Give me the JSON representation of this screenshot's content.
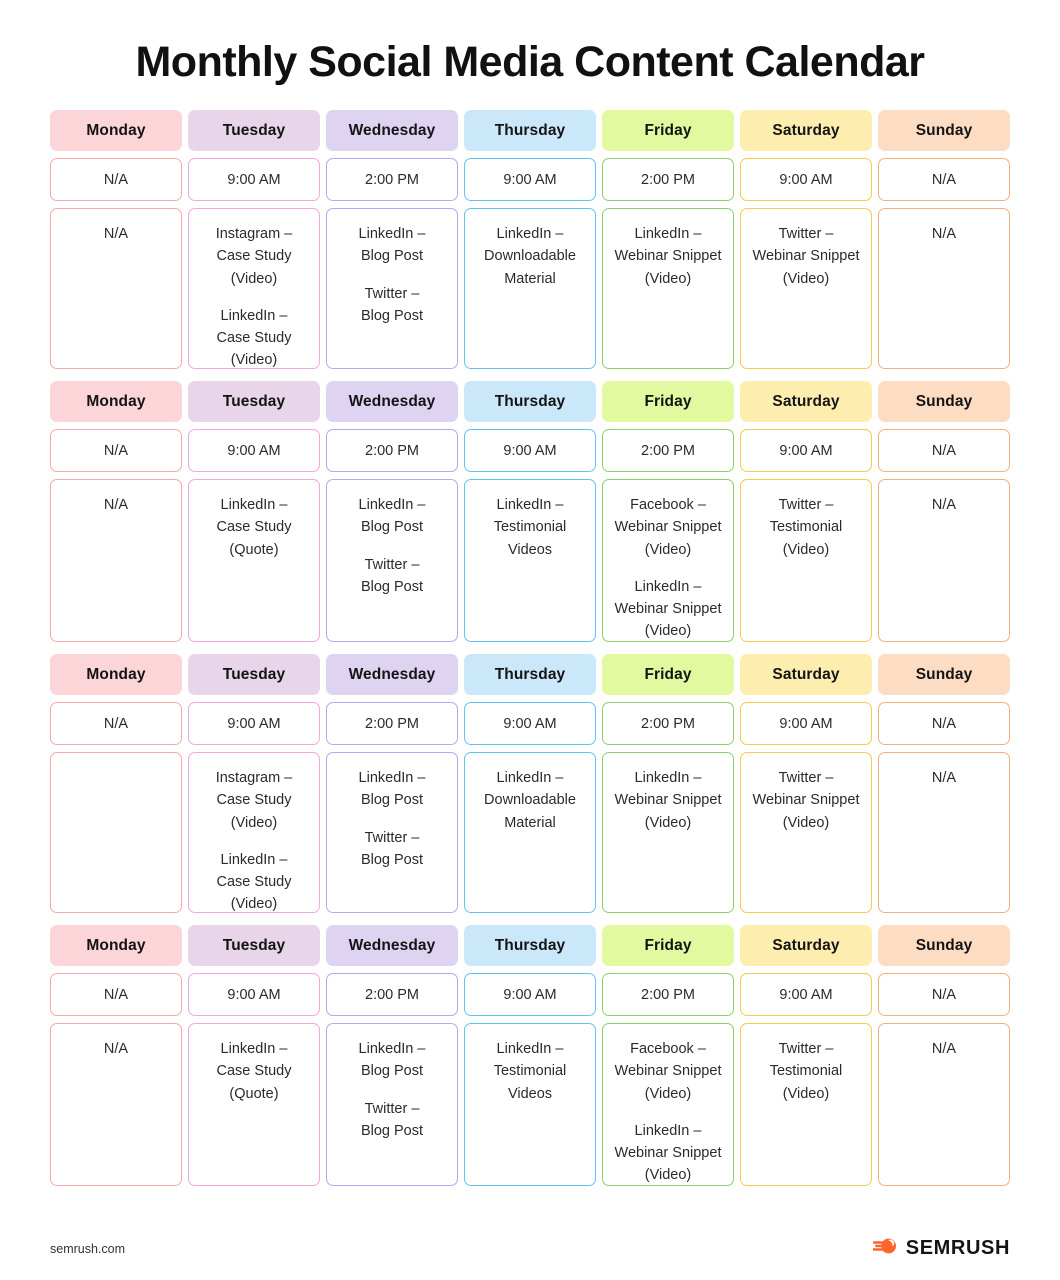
{
  "title": "Monthly Social Media Content Calendar",
  "footer": {
    "url": "semrush.com",
    "brand_name": "SEMRUSH",
    "brand_mark_color": "#ff642d"
  },
  "day_styles": {
    "Monday": {
      "header_bg": "#fbd5d8",
      "border": "#f7a8ab"
    },
    "Tuesday": {
      "header_bg": "#e8d5ea",
      "border": "#f5a7da"
    },
    "Wednesday": {
      "header_bg": "#ded4f2",
      "border": "#b9a6f2"
    },
    "Thursday": {
      "header_bg": "#cbe8fb",
      "border": "#63c3f0"
    },
    "Friday": {
      "header_bg": "#e2f9a0",
      "border": "#8dd06a"
    },
    "Saturday": {
      "header_bg": "#fdeeb0",
      "border": "#f7cb4b"
    },
    "Sunday": {
      "header_bg": "#fcddc4",
      "border": "#f4b07c"
    }
  },
  "weeks": [
    {
      "name": "week-1",
      "days": [
        {
          "day": "Monday",
          "time": "N/A",
          "entries": [
            "N/A"
          ]
        },
        {
          "day": "Tuesday",
          "time": "9:00 AM",
          "entries": [
            "Instagram –\nCase Study\n(Video)",
            "LinkedIn –\nCase Study\n(Video)"
          ]
        },
        {
          "day": "Wednesday",
          "time": "2:00 PM",
          "entries": [
            "LinkedIn –\nBlog Post",
            "Twitter –\nBlog Post"
          ]
        },
        {
          "day": "Thursday",
          "time": "9:00 AM",
          "entries": [
            "LinkedIn –\nDownloadable\nMaterial"
          ]
        },
        {
          "day": "Friday",
          "time": "2:00 PM",
          "entries": [
            "LinkedIn –\nWebinar Snippet\n(Video)"
          ]
        },
        {
          "day": "Saturday",
          "time": "9:00 AM",
          "entries": [
            "Twitter –\nWebinar Snippet\n(Video)"
          ]
        },
        {
          "day": "Sunday",
          "time": "N/A",
          "entries": [
            "N/A"
          ]
        }
      ]
    },
    {
      "name": "week-2",
      "days": [
        {
          "day": "Monday",
          "time": "N/A",
          "entries": [
            "N/A"
          ]
        },
        {
          "day": "Tuesday",
          "time": "9:00 AM",
          "entries": [
            "LinkedIn –\nCase Study\n(Quote)"
          ]
        },
        {
          "day": "Wednesday",
          "time": "2:00 PM",
          "entries": [
            "LinkedIn –\nBlog Post",
            "Twitter –\nBlog Post"
          ]
        },
        {
          "day": "Thursday",
          "time": "9:00 AM",
          "entries": [
            "LinkedIn –\nTestimonial\nVideos"
          ]
        },
        {
          "day": "Friday",
          "time": "2:00 PM",
          "entries": [
            "Facebook –\nWebinar Snippet\n(Video)",
            "LinkedIn –\nWebinar Snippet\n(Video)"
          ]
        },
        {
          "day": "Saturday",
          "time": "9:00 AM",
          "entries": [
            "Twitter –\nTestimonial\n(Video)"
          ]
        },
        {
          "day": "Sunday",
          "time": "N/A",
          "entries": [
            "N/A"
          ]
        }
      ]
    },
    {
      "name": "week-3",
      "days": [
        {
          "day": "Monday",
          "time": "N/A",
          "entries": []
        },
        {
          "day": "Tuesday",
          "time": "9:00 AM",
          "entries": [
            "Instagram –\nCase Study\n(Video)",
            "LinkedIn –\nCase Study\n(Video)"
          ]
        },
        {
          "day": "Wednesday",
          "time": "2:00 PM",
          "entries": [
            "LinkedIn –\nBlog Post",
            "Twitter –\nBlog Post"
          ]
        },
        {
          "day": "Thursday",
          "time": "9:00 AM",
          "entries": [
            "LinkedIn –\nDownloadable\nMaterial"
          ]
        },
        {
          "day": "Friday",
          "time": "2:00 PM",
          "entries": [
            "LinkedIn –\nWebinar Snippet\n(Video)"
          ]
        },
        {
          "day": "Saturday",
          "time": "9:00 AM",
          "entries": [
            "Twitter –\nWebinar Snippet\n(Video)"
          ]
        },
        {
          "day": "Sunday",
          "time": "N/A",
          "entries": [
            "N/A"
          ]
        }
      ]
    },
    {
      "name": "week-4",
      "days": [
        {
          "day": "Monday",
          "time": "N/A",
          "entries": [
            "N/A"
          ]
        },
        {
          "day": "Tuesday",
          "time": "9:00 AM",
          "entries": [
            "LinkedIn –\nCase Study\n(Quote)"
          ]
        },
        {
          "day": "Wednesday",
          "time": "2:00 PM",
          "entries": [
            "LinkedIn –\nBlog Post",
            "Twitter –\nBlog Post"
          ]
        },
        {
          "day": "Thursday",
          "time": "9:00 AM",
          "entries": [
            "LinkedIn –\nTestimonial\nVideos"
          ]
        },
        {
          "day": "Friday",
          "time": "2:00 PM",
          "entries": [
            "Facebook –\nWebinar Snippet\n(Video)",
            "LinkedIn –\nWebinar Snippet\n(Video)"
          ]
        },
        {
          "day": "Saturday",
          "time": "9:00 AM",
          "entries": [
            "Twitter –\nTestimonial\n(Video)"
          ]
        },
        {
          "day": "Sunday",
          "time": "N/A",
          "entries": [
            "N/A"
          ]
        }
      ]
    }
  ]
}
